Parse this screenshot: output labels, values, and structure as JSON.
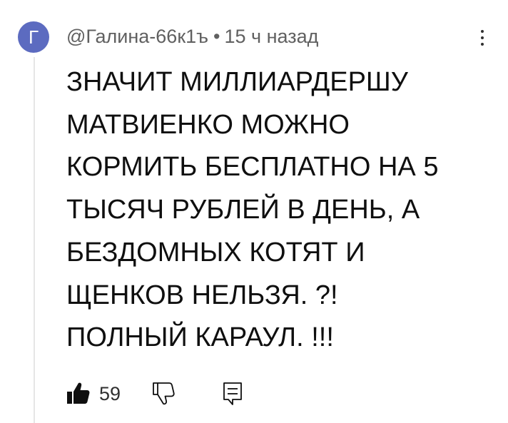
{
  "comment": {
    "avatar_letter": "Г",
    "avatar_color": "#5c6bc0",
    "author": "@Галина-66к1ъ",
    "separator": "•",
    "timestamp": "15 ч назад",
    "text": "ЗНАЧИТ МИЛЛИАРДЕРШУ\nМАТВИЕНКО   МОЖНО\nКОРМИТЬ БЕСПЛАТНО НА  5\nТЫСЯЧ РУБЛЕЙ В ДЕНЬ, А\nБЕЗДОМНЫХ КОТЯТ И\nЩЕНКОВ НЕЛЬЗЯ. ?!\nПОЛНЫЙ КАРАУЛ. !!!",
    "like_count": "59"
  },
  "icons": {
    "like": "thumbs-up-icon",
    "dislike": "thumbs-down-icon",
    "reply": "reply-comment-icon",
    "more": "more-vertical-icon"
  }
}
